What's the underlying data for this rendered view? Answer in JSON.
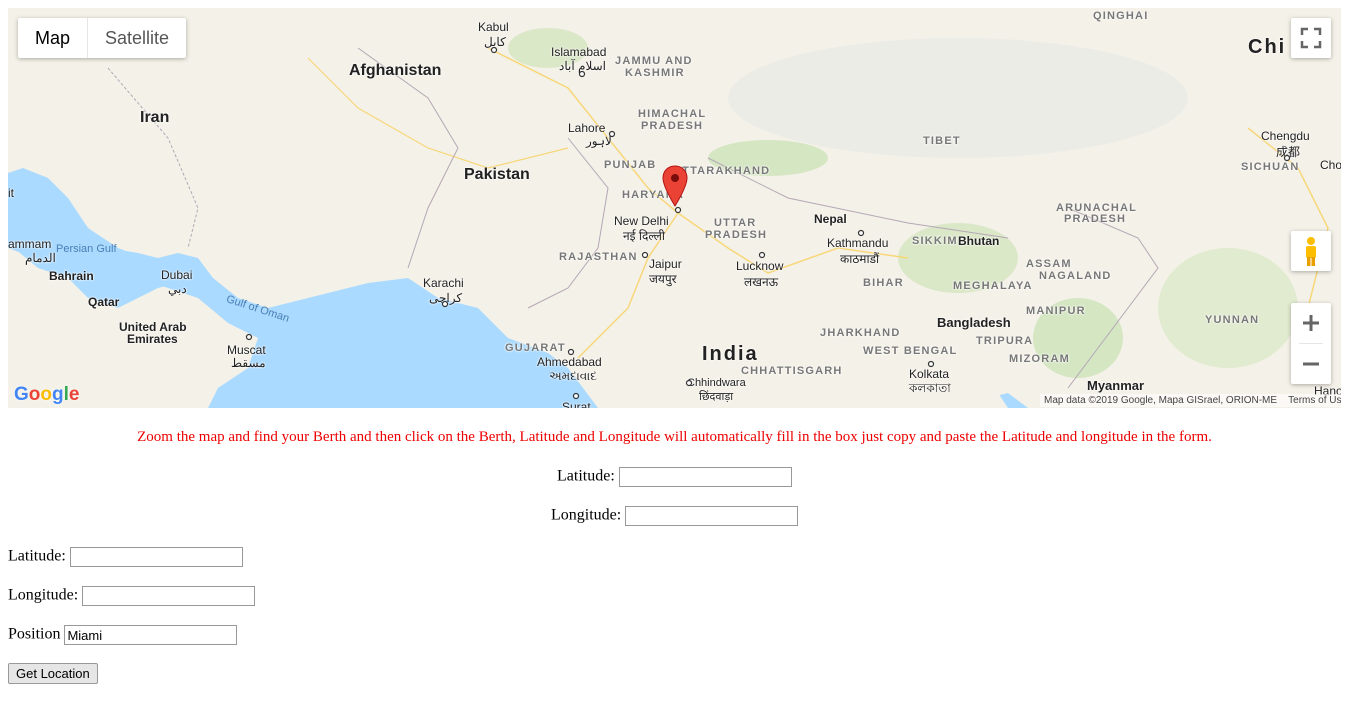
{
  "map": {
    "type_control": {
      "map_label": "Map",
      "satellite_label": "Satellite"
    },
    "logo_text": "Google",
    "attribution": "Map data ©2019 Google, Mapa GISrael, ORION-ME",
    "terms": "Terms of Use",
    "labels": {
      "qinghai": "QINGHAI",
      "kabul": "Kabul",
      "kabul_native": "کابل",
      "islamabad": "Islamabad",
      "islamabad_native": "اسلام آباد",
      "jammu": "JAMMU AND",
      "kashmir": "KASHMIR",
      "afghanistan": "Afghanistan",
      "china": "Chi",
      "iran": "Iran",
      "himachal": "HIMACHAL",
      "pradesh1": "PRADESH",
      "lahore": "Lahore",
      "lahore_native": "لاہور",
      "tibet": "TIBET",
      "chengdu": "Chengdu",
      "chengdu_native": "成都",
      "sichuan": "SICHUAN",
      "cho": "Cho",
      "punjab": "PUNJAB",
      "uttarakhand": "UTTARAKHAND",
      "pakistan": "Pakistan",
      "haryana": "HARYANA",
      "newdelhi": "New Delhi",
      "newdelhi_native": "नई दिल्ली",
      "uttar": "UTTAR",
      "pradesh2": "PRADESH",
      "nepal": "Nepal",
      "arunachal": "ARUNACHAL",
      "pradesh3": "PRADESH",
      "it": "it",
      "ammam": "ammam",
      "ammam_native": "الدمام",
      "persian_gulf": "Persian Gulf",
      "rajasthan": "RAJASTHAN",
      "jaipur": "Jaipur",
      "jaipur_native": "जयपुर",
      "kathmandu": "Kathmandu",
      "kathmandu_native": "काठमाडौं",
      "sikkim": "SIKKIM",
      "bhutan": "Bhutan",
      "assam": "ASSAM",
      "nagaland": "NAGALAND",
      "bahrain": "Bahrain",
      "dubai": "Dubai",
      "dubai_native": "دبي",
      "karachi": "Karachi",
      "karachi_native": "کراچی",
      "lucknow": "Lucknow",
      "lucknow_native": "लखनऊ",
      "bihar": "BIHAR",
      "meghalaya": "MEGHALAYA",
      "qatar": "Qatar",
      "gulf_oman": "Gulf of Oman",
      "manipur": "MANIPUR",
      "uae1": "United Arab",
      "uae2": "Emirates",
      "jharkhand": "JHARKHAND",
      "bangladesh": "Bangladesh",
      "yunnan": "YUNNAN",
      "muscat": "Muscat",
      "muscat_native": "مسقط",
      "tripura": "TRIPURA",
      "gujarat": "GUJARAT",
      "west_bengal": "WEST BENGAL",
      "ahmedabad": "Ahmedabad",
      "ahmedabad_native": "અમદાવાદ",
      "india": "India",
      "mizoram": "MIZORAM",
      "chhattisgarh": "CHHATTISGARH",
      "kolkata": "Kolkata",
      "kolkata_native": "কলকাতা",
      "chhindwara": "Chhindwara",
      "chhindwara_native": "छिंदवाड़ा",
      "myanmar": "Myanmar",
      "hano": "Hano",
      "surat": "Surat"
    }
  },
  "instructions": "Zoom the map and find your Berth and then click on the Berth, Latitude and Longitude will automatically fill in the box just copy and paste the Latitude and longitude in the form.",
  "centered_form": {
    "latitude_label": "Latitude:",
    "latitude_value": "",
    "longitude_label": "Longitude:",
    "longitude_value": ""
  },
  "left_form": {
    "latitude_label": "Latitude:",
    "latitude_value": "",
    "longitude_label": "Longitude:",
    "longitude_value": "",
    "position_label": "Position",
    "position_value": "Miami"
  },
  "get_location_button": "Get Location",
  "colors": {
    "instruction_text": "#ee0000",
    "water": "#aadaff",
    "land": "#f4f1e8",
    "marker": "#ea4335"
  }
}
